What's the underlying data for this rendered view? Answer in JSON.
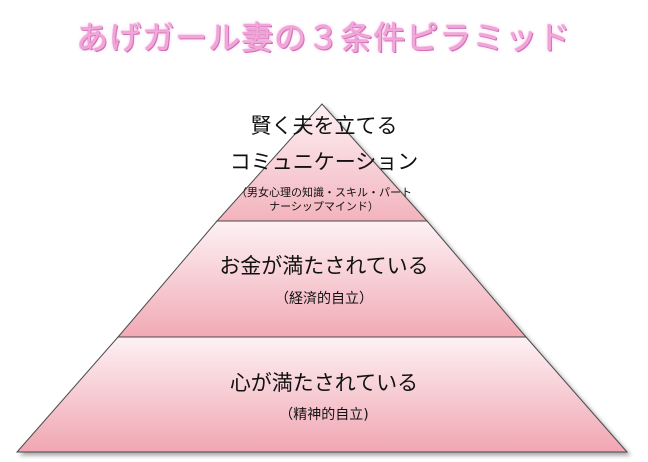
{
  "title": "あげガール妻の３条件ピラミッド",
  "tiers": [
    {
      "main_lines": [
        "賢く夫を立てる",
        "コミュニケーション"
      ],
      "sub_lines": [
        "（男女心理の知識・スキル・パート",
        "ナーシップマインド）"
      ]
    },
    {
      "main_lines": [
        "お金が満たされている"
      ],
      "sub_lines": [
        "（経済的自立）"
      ]
    },
    {
      "main_lines": [
        "心が満たされている"
      ],
      "sub_lines": [
        "（精神的自立)"
      ]
    }
  ],
  "colors": {
    "title_fill": "#f2a6da",
    "title_outline": "#b94a9a",
    "tier_fill_top": "#fbe9ee",
    "tier_fill_bottom": "#f1a9b4",
    "tier_stroke": "#4a4a4a",
    "text": "#111111"
  }
}
